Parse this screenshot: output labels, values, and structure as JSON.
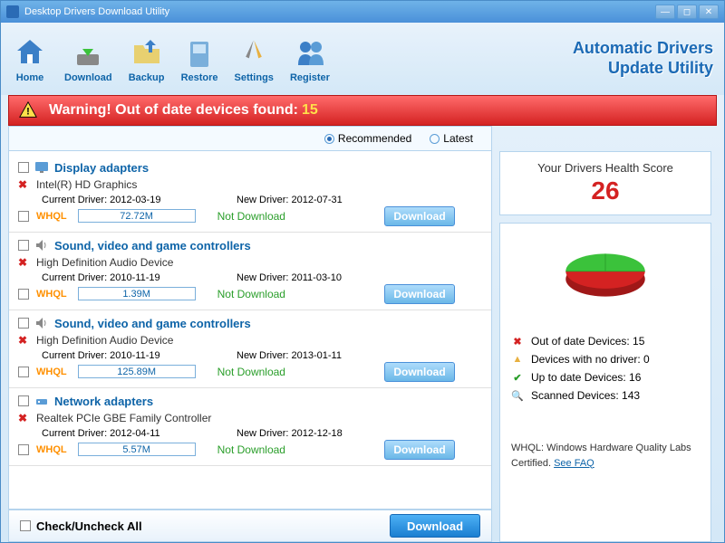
{
  "title": "Desktop Drivers Download Utility",
  "toolbar": [
    {
      "label": "Home",
      "icon": "home"
    },
    {
      "label": "Download",
      "icon": "download"
    },
    {
      "label": "Backup",
      "icon": "backup"
    },
    {
      "label": "Restore",
      "icon": "restore"
    },
    {
      "label": "Settings",
      "icon": "settings"
    },
    {
      "label": "Register",
      "icon": "register"
    }
  ],
  "brand": {
    "line1": "Automatic Drivers",
    "line2": "Update   Utility"
  },
  "warning": {
    "text": "Warning! Out of date devices found:",
    "count": "15"
  },
  "filters": {
    "recommended": "Recommended",
    "latest": "Latest"
  },
  "devices": [
    {
      "category": "Display adapters",
      "name": "Intel(R) HD Graphics",
      "current": "Current Driver: 2012-03-19",
      "new": "New Driver: 2012-07-31",
      "whql": "WHQL",
      "size": "72.72M",
      "status": "Not Download",
      "btn": "Download",
      "icon": "display"
    },
    {
      "category": "Sound, video and game controllers",
      "name": "High Definition Audio Device",
      "current": "Current Driver: 2010-11-19",
      "new": "New Driver: 2011-03-10",
      "whql": "WHQL",
      "size": "1.39M",
      "status": "Not Download",
      "btn": "Download",
      "icon": "sound"
    },
    {
      "category": "Sound, video and game controllers",
      "name": "High Definition Audio Device",
      "current": "Current Driver: 2010-11-19",
      "new": "New Driver: 2013-01-11",
      "whql": "WHQL",
      "size": "125.89M",
      "status": "Not Download",
      "btn": "Download",
      "icon": "sound"
    },
    {
      "category": "Network adapters",
      "name": "Realtek PCIe GBE Family Controller",
      "current": "Current Driver: 2012-04-11",
      "new": "New Driver: 2012-12-18",
      "whql": "WHQL",
      "size": "5.57M",
      "status": "Not Download",
      "btn": "Download",
      "icon": "network"
    }
  ],
  "footer": {
    "checkall": "Check/Uncheck All",
    "download": "Download"
  },
  "score": {
    "title": "Your Drivers Health Score",
    "value": "26"
  },
  "stats": [
    {
      "icon": "x",
      "text": "Out of date Devices: 15"
    },
    {
      "icon": "warn",
      "text": "Devices with no driver: 0"
    },
    {
      "icon": "check",
      "text": "Up to date Devices: 16"
    },
    {
      "icon": "search",
      "text": "Scanned Devices: 143"
    }
  ],
  "whql_note": {
    "text": "WHQL: Windows Hardware Quality Labs Certified.",
    "link": "See FAQ"
  }
}
